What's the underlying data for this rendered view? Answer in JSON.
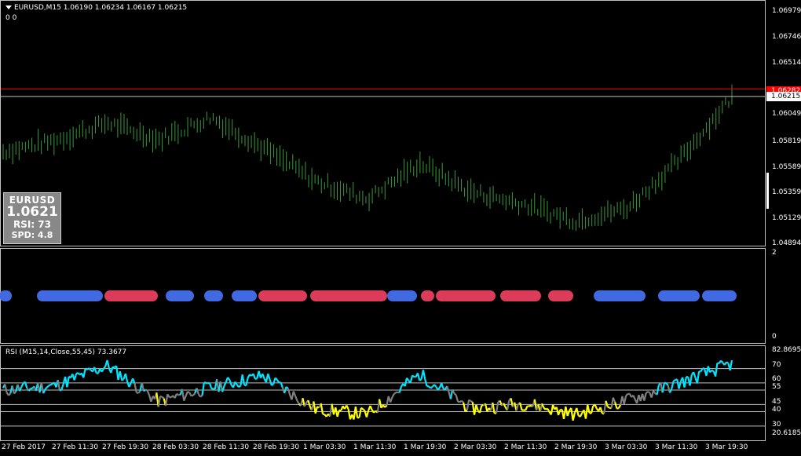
{
  "header": {
    "symbol_line": "EURUSD,M15  1.06190 1.06234 1.06167 1.06215",
    "sub_line": "0 0"
  },
  "info_box": {
    "symbol": "EURUSD",
    "price": "1.0621",
    "rsi": "RSI: 73",
    "spd": "SPD: 4.8",
    "bg_color": "#888888"
  },
  "price_scale": [
    "1.06979",
    "1.06746",
    "1.06514",
    "1.06282",
    "1.06049",
    "1.05819",
    "1.05589",
    "1.05359",
    "1.05129",
    "1.04894"
  ],
  "current_price_tag": "1.06215",
  "red_line_tag": "1.06282",
  "indicator_scale": {
    "top": "2",
    "bottom": "0"
  },
  "rsi": {
    "label": "RSI (M15,14,Close,55,45) 73.3677",
    "scale_top": "82.8695",
    "scale_bottom": "20.6185",
    "levels": [
      "70",
      "60",
      "55",
      "45",
      "40",
      "30"
    ]
  },
  "time_axis": [
    "27 Feb 2017",
    "27 Feb 11:30",
    "27 Feb 19:30",
    "28 Feb 03:30",
    "28 Feb 11:30",
    "28 Feb 19:30",
    "1 Mar 03:30",
    "1 Mar 11:30",
    "1 Mar 19:30",
    "2 Mar 03:30",
    "2 Mar 11:30",
    "2 Mar 19:30",
    "3 Mar 03:30",
    "3 Mar 11:30",
    "3 Mar 19:30"
  ],
  "colors": {
    "candle": "#3a9a3a",
    "bull_dot": "#4169e1",
    "bear_dot": "#dc3c5a",
    "rsi_high": "#00e5ff",
    "rsi_low": "#ffff00",
    "rsi_neutral": "#808080",
    "red_line": "#ff0000"
  },
  "chart_data": [
    {
      "type": "line",
      "title": "EURUSD,M15",
      "ylim": [
        1.04894,
        1.06979
      ],
      "x": [
        "27 Feb 2017",
        "27 Feb 11:30",
        "27 Feb 19:30",
        "28 Feb 03:30",
        "28 Feb 11:30",
        "28 Feb 19:30",
        "1 Mar 03:30",
        "1 Mar 11:30",
        "1 Mar 19:30",
        "2 Mar 03:30",
        "2 Mar 11:30",
        "2 Mar 19:30",
        "3 Mar 03:30",
        "3 Mar 11:30",
        "3 Mar 19:30"
      ],
      "series": [
        {
          "name": "EURUSD",
          "values": [
            1.0572,
            1.0582,
            1.0598,
            1.0583,
            1.0603,
            1.0575,
            1.0546,
            1.053,
            1.0562,
            1.0536,
            1.0525,
            1.051,
            1.0522,
            1.0565,
            1.0621
          ]
        }
      ]
    },
    {
      "type": "line",
      "title": "RSI (M15,14,Close,55,45) 73.3677",
      "ylim": [
        20.6185,
        82.8695
      ],
      "series": [
        {
          "name": "RSI",
          "values": [
            55,
            58,
            72,
            47,
            57,
            65,
            42,
            38,
            66,
            42,
            46,
            38,
            48,
            60,
            73.37
          ]
        }
      ]
    }
  ]
}
